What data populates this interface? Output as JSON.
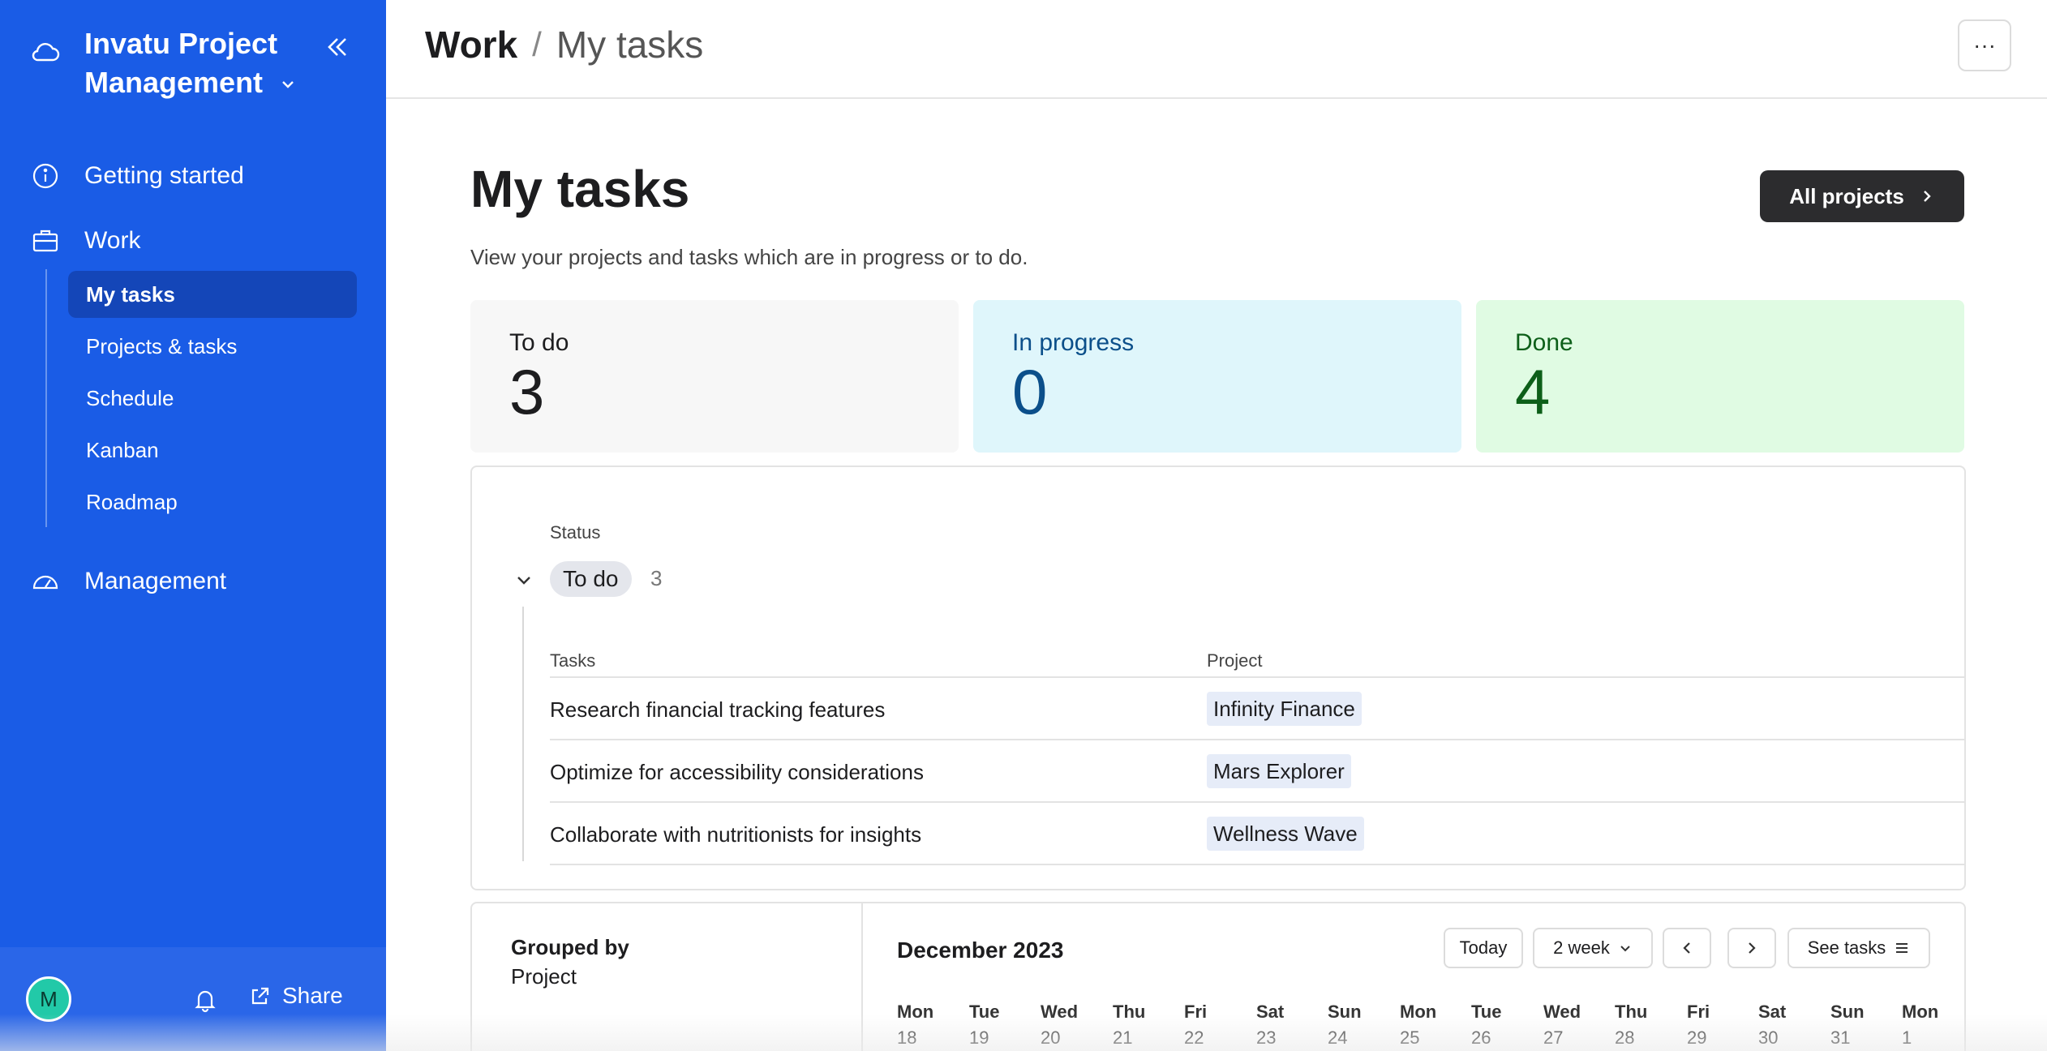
{
  "sidebar": {
    "brand": "Invatu Project Management",
    "nav": [
      {
        "label": "Getting started"
      },
      {
        "label": "Work"
      },
      {
        "label": "Management"
      }
    ],
    "work_items": [
      {
        "label": "My tasks",
        "active": true
      },
      {
        "label": "Projects & tasks"
      },
      {
        "label": "Schedule"
      },
      {
        "label": "Kanban"
      },
      {
        "label": "Roadmap"
      }
    ],
    "avatar": "M",
    "share": "Share"
  },
  "header": {
    "crumb_root": "Work",
    "crumb_sep": "/",
    "crumb_current": "My tasks",
    "more": "···"
  },
  "main": {
    "title": "My tasks",
    "subtitle": "View your projects and tasks which are in progress or to do.",
    "all_projects": "All projects",
    "summary": [
      {
        "label": "To do",
        "value": "3"
      },
      {
        "label": "In progress",
        "value": "0"
      },
      {
        "label": "Done",
        "value": "4"
      }
    ],
    "status_group": {
      "label": "Status",
      "name": "To do",
      "count": "3",
      "columns": [
        "Tasks",
        "Project"
      ],
      "rows": [
        {
          "task": "Research financial tracking features",
          "project": "Infinity Finance"
        },
        {
          "task": "Optimize for accessibility considerations",
          "project": "Mars Explorer"
        },
        {
          "task": "Collaborate with nutritionists for insights",
          "project": "Wellness Wave"
        }
      ]
    },
    "schedule": {
      "grouped_label": "Grouped by",
      "grouped_value": "Project",
      "month": "December 2023",
      "today": "Today",
      "range": "2 week",
      "see_tasks": "See tasks",
      "days": [
        {
          "name": "Mon",
          "date": "18"
        },
        {
          "name": "Tue",
          "date": "19"
        },
        {
          "name": "Wed",
          "date": "20"
        },
        {
          "name": "Thu",
          "date": "21"
        },
        {
          "name": "Fri",
          "date": "22"
        },
        {
          "name": "Sat",
          "date": "23"
        },
        {
          "name": "Sun",
          "date": "24"
        },
        {
          "name": "Mon",
          "date": "25"
        },
        {
          "name": "Tue",
          "date": "26"
        },
        {
          "name": "Wed",
          "date": "27"
        },
        {
          "name": "Thu",
          "date": "28"
        },
        {
          "name": "Fri",
          "date": "29"
        },
        {
          "name": "Sat",
          "date": "30"
        },
        {
          "name": "Sun",
          "date": "31"
        },
        {
          "name": "Mon",
          "date": "1"
        }
      ]
    }
  },
  "colors": {
    "sidebar": "#1a5ce6",
    "sidebar_active": "#1446b8",
    "in_progress": "#0b4f8a",
    "done": "#0d5f19"
  }
}
